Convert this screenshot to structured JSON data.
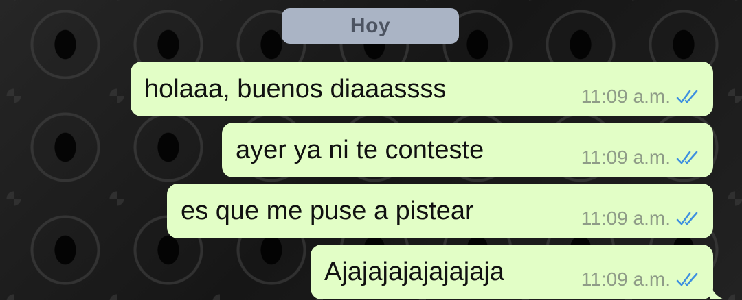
{
  "date_separator": "Hoy",
  "messages": [
    {
      "text": "holaaa, buenos diaaassss",
      "time": "11:09 a.m.",
      "status_icon": "double-check-read-icon"
    },
    {
      "text": "ayer ya ni te conteste",
      "time": "11:09 a.m.",
      "status_icon": "double-check-read-icon"
    },
    {
      "text": "es que me puse a pistear",
      "time": "11:09 a.m.",
      "status_icon": "double-check-read-icon"
    },
    {
      "text": "Ajajajajajajajaja",
      "time": "11:09 a.m.",
      "status_icon": "double-check-read-icon"
    }
  ],
  "colors": {
    "bubble_outgoing": "#e2fec6",
    "read_ticks": "#3d8fe0",
    "date_chip": "#aab4c5"
  }
}
